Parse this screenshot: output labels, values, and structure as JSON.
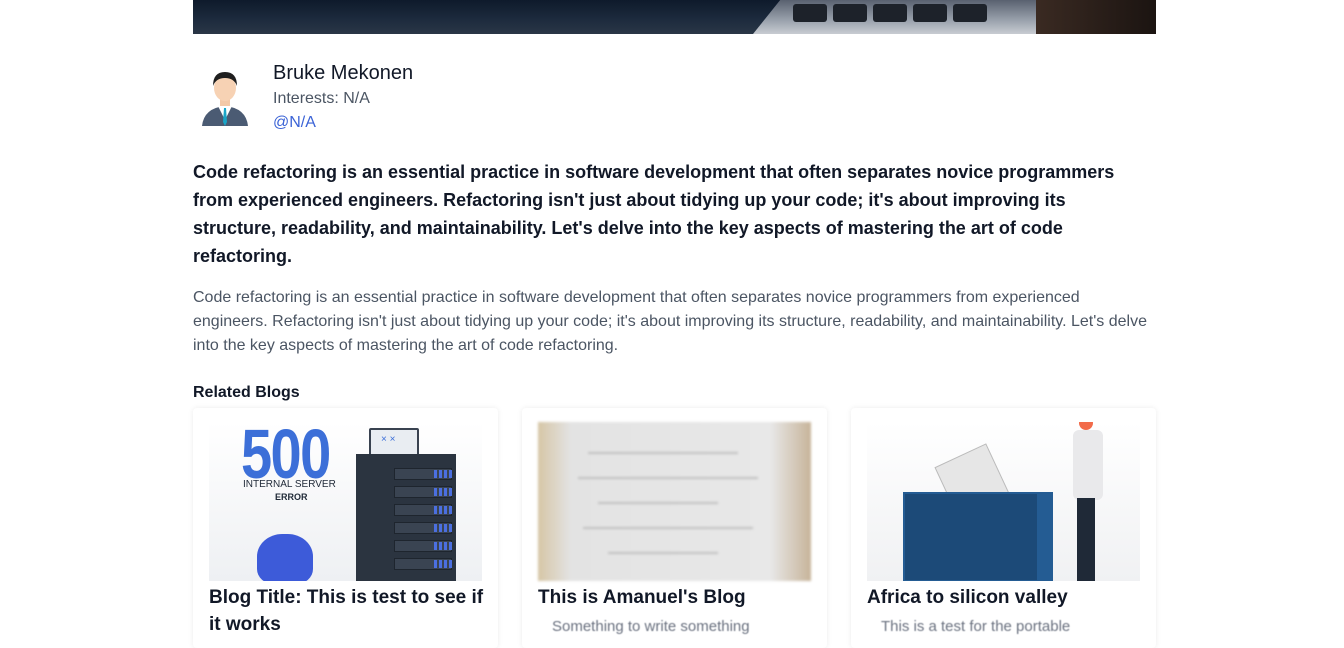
{
  "author": {
    "name": "Bruke Mekonen",
    "interests": "Interests: N/A",
    "handle": "@N/A"
  },
  "post": {
    "lead": "Code refactoring is an essential practice in software development that often separates novice programmers from experienced engineers. Refactoring isn't just about tidying up your code; it's about improving its structure, readability, and maintainability. Let's delve into the key aspects of mastering the art of code refactoring.",
    "body": "Code refactoring is an essential practice in software development that often separates novice programmers from experienced engineers. Refactoring isn't just about tidying up your code; it's about improving its structure, readability, and maintainability. Let's delve into the key aspects of mastering the art of code refactoring."
  },
  "related": {
    "heading": "Related Blogs",
    "cards": [
      {
        "title": "Blog Title: This is test to see if it works",
        "image_text": {
          "big": "500",
          "line1": "INTERNAL SERVER",
          "line2": "ERROR",
          "screen": "× ×"
        }
      },
      {
        "title": "This is Amanuel's Blog",
        "snippet": "Something to write something"
      },
      {
        "title": "Africa to silicon valley",
        "snippet": "This is a test for the portable"
      }
    ]
  },
  "colors": {
    "link": "#3b63d6",
    "text": "#111827",
    "muted": "#4b5563"
  }
}
